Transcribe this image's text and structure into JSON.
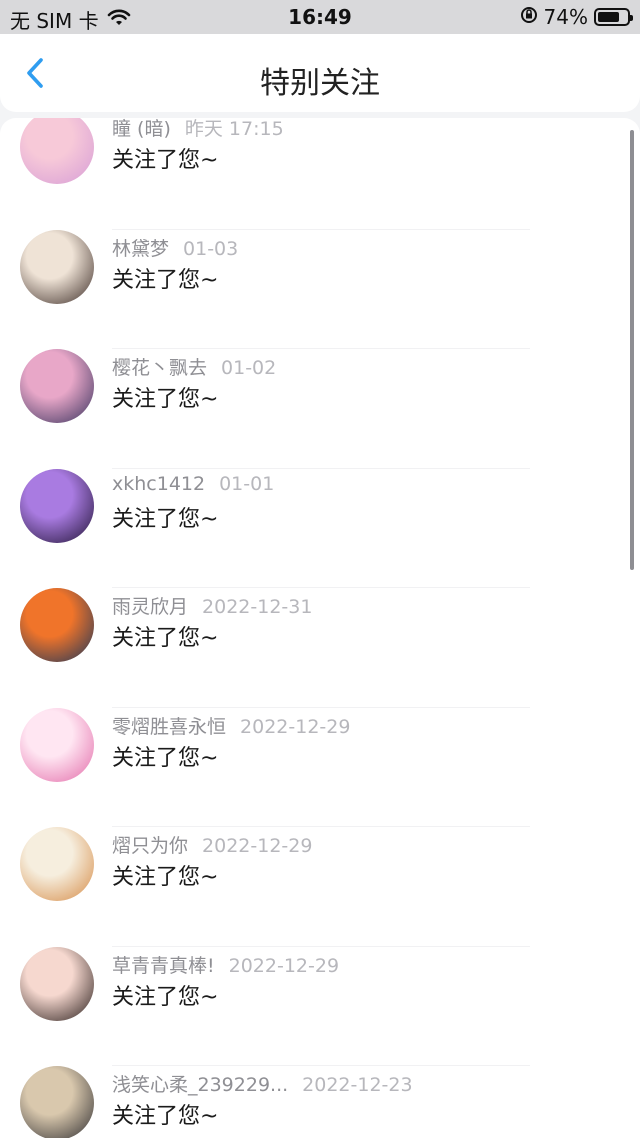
{
  "status_bar": {
    "carrier": "无 SIM 卡",
    "time": "16:49",
    "battery": "74%",
    "battery_level": 0.74
  },
  "nav": {
    "title": "特别关注"
  },
  "items": [
    {
      "name": "瞳 (暗)",
      "time": "昨天 17:15",
      "message": "关注了您~",
      "avatar_colors": [
        "#f7c9d8",
        "#d69cd6"
      ]
    },
    {
      "name": "林黛梦",
      "time": "01-03",
      "message": "关注了您~",
      "avatar_colors": [
        "#efe3d6",
        "#3a2a25"
      ]
    },
    {
      "name": "樱花丶飘去",
      "time": "01-02",
      "message": "关注了您~",
      "avatar_colors": [
        "#e8a7c8",
        "#35305b"
      ]
    },
    {
      "name": "xkhc1412",
      "time": "01-01",
      "message": "关注了您~",
      "avatar_colors": [
        "#a97be1",
        "#1f1233"
      ]
    },
    {
      "name": "雨灵欣月",
      "time": "2022-12-31",
      "message": "关注了您~",
      "avatar_colors": [
        "#f0742a",
        "#19345a"
      ]
    },
    {
      "name": "零熠胜喜永恒",
      "time": "2022-12-29",
      "message": "关注了您~",
      "avatar_colors": [
        "#ffe6f2",
        "#e26aa8"
      ]
    },
    {
      "name": "熠只为你",
      "time": "2022-12-29",
      "message": "关注了您~",
      "avatar_colors": [
        "#f6eede",
        "#d58a45"
      ]
    },
    {
      "name": "草青青真棒!",
      "time": "2022-12-29",
      "message": "关注了您~",
      "avatar_colors": [
        "#f6d8cf",
        "#251a18"
      ]
    },
    {
      "name": "浅笑心柔_239229...",
      "time": "2022-12-23",
      "message": "关注了您~",
      "avatar_colors": [
        "#d9c8ad",
        "#2b2a2e"
      ]
    }
  ]
}
